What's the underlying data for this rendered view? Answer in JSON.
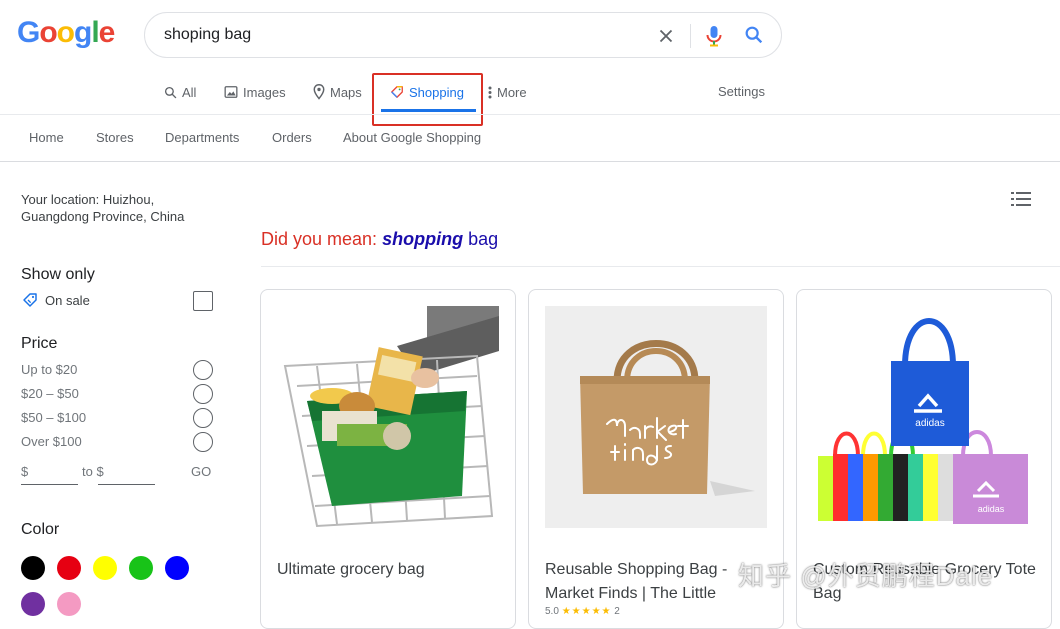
{
  "logo": {
    "letters": [
      "G",
      "o",
      "o",
      "g",
      "l",
      "e"
    ],
    "colors": [
      "#4285f4",
      "#ea4335",
      "#fbbc05",
      "#4285f4",
      "#34a853",
      "#ea4335"
    ]
  },
  "search": {
    "query": "shoping bag"
  },
  "tabs": [
    {
      "label": "All",
      "icon": "search-icon"
    },
    {
      "label": "Images",
      "icon": "image-icon"
    },
    {
      "label": "Maps",
      "icon": "map-pin-icon"
    },
    {
      "label": "Shopping",
      "icon": "tag-icon",
      "active": true
    },
    {
      "label": "More",
      "icon": "more-vert-icon"
    }
  ],
  "settings_label": "Settings",
  "subnav": [
    "Home",
    "Stores",
    "Departments",
    "Orders",
    "About Google Shopping"
  ],
  "sidebar": {
    "location": "Your location: Huizhou, Guangdong Province, China",
    "show_only_heading": "Show only",
    "on_sale_label": "On sale",
    "price_heading": "Price",
    "price_options": [
      "Up to $20",
      "$20 – $50",
      "$50 – $100",
      "Over $100"
    ],
    "price_from_label": "$",
    "price_to_label": "to $",
    "go_label": "GO",
    "color_heading": "Color",
    "colors": [
      "#000000",
      "#e60012",
      "#ffff00",
      "#18c318",
      "#0000ff",
      "#7030a0",
      "#f49ac2"
    ]
  },
  "did_you_mean": {
    "label": "Did you mean:",
    "suggestion": "shopping",
    "rest": "bag"
  },
  "products": [
    {
      "title": "Ultimate grocery bag"
    },
    {
      "title": "Reusable Shopping Bag - Market Finds | The Little",
      "rating": "5.0",
      "stars": "★★★★★",
      "reviews": "2"
    },
    {
      "title": "Custom Reusable Grocery Tote Bag"
    }
  ],
  "watermark": "知乎 @外贸鹏程Dale",
  "accent_color": "#1a73e8",
  "highlight_color": "#d93025"
}
